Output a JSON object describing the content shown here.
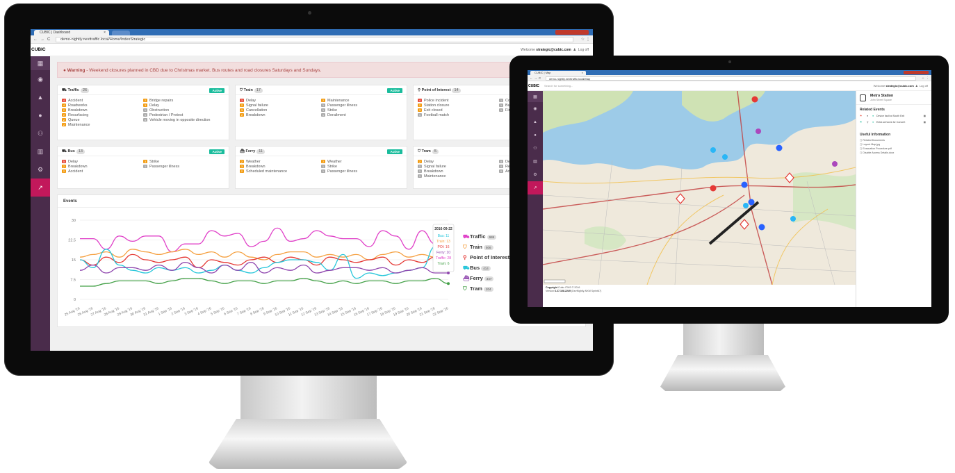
{
  "dashboard": {
    "tab_title": "CUBIC | Dashboard",
    "tab_close": "×",
    "url": "demo-nightly.nexttraffic.local/Home/IndexStrategic",
    "brand": "CUBIC",
    "welcome_prefix": "Welcome",
    "welcome_user": "strategic@cubic.com",
    "logout": "Log off",
    "warning_label": "Warning",
    "warning_text": " - Weekend closures planned in CBD due to Christmas market. Bus routes and road closures Saturdays and Sundays.",
    "active_label": "Active",
    "cards": {
      "traffic": {
        "title": "Traffic",
        "count": "26",
        "left": [
          {
            "n": "4",
            "c": "red",
            "t": "Accident"
          },
          {
            "n": "4",
            "c": "orange",
            "t": "Roadworks"
          },
          {
            "n": "2",
            "c": "orange",
            "t": "Breakdown"
          },
          {
            "n": "2",
            "c": "orange",
            "t": "Resurfacing"
          },
          {
            "n": "2",
            "c": "orange",
            "t": "Queue"
          },
          {
            "n": "2",
            "c": "orange",
            "t": "Maintenance"
          }
        ],
        "right": [
          {
            "n": "2",
            "c": "orange",
            "t": "Bridge repairs"
          },
          {
            "n": "3",
            "c": "orange",
            "t": "Delay"
          },
          {
            "n": "1",
            "c": "grey",
            "t": "Obstruction"
          },
          {
            "n": "1",
            "c": "grey",
            "t": "Pedestrian / Protest"
          },
          {
            "n": "0",
            "c": "grey",
            "t": "Vehicle moving in opposite direction"
          }
        ]
      },
      "train": {
        "title": "Train",
        "count": "17",
        "left": [
          {
            "n": "3",
            "c": "red",
            "t": "Delay"
          },
          {
            "n": "2",
            "c": "orange",
            "t": "Signal failure"
          },
          {
            "n": "3",
            "c": "orange",
            "t": "Cancellation"
          },
          {
            "n": "2",
            "c": "orange",
            "t": "Breakdown"
          }
        ],
        "right": [
          {
            "n": "2",
            "c": "orange",
            "t": "Maintenance"
          },
          {
            "n": "1",
            "c": "grey",
            "t": "Passenger illness"
          },
          {
            "n": "1",
            "c": "grey",
            "t": "Strike"
          },
          {
            "n": "1",
            "c": "grey",
            "t": "Derailment"
          }
        ]
      },
      "poi": {
        "title": "Point of Interest",
        "count": "14",
        "left": [
          {
            "n": "4",
            "c": "red",
            "t": "Police incident"
          },
          {
            "n": "2",
            "c": "orange",
            "t": "Station closure"
          },
          {
            "n": "3",
            "c": "orange",
            "t": "Exit closed"
          },
          {
            "n": "1",
            "c": "grey",
            "t": "Football match"
          }
        ],
        "right": [
          {
            "n": "1",
            "c": "grey",
            "t": "Co"
          },
          {
            "n": "1",
            "c": "grey",
            "t": "Bu"
          },
          {
            "n": "1",
            "c": "grey",
            "t": "Fir"
          }
        ]
      },
      "bus": {
        "title": "Bus",
        "count": "13",
        "left": [
          {
            "n": "5",
            "c": "red",
            "t": "Delay"
          },
          {
            "n": "2",
            "c": "orange",
            "t": "Breakdown"
          },
          {
            "n": "2",
            "c": "orange",
            "t": "Accident"
          }
        ],
        "right": [
          {
            "n": "3",
            "c": "orange",
            "t": "Strike"
          },
          {
            "n": "1",
            "c": "grey",
            "t": "Passenger illness"
          }
        ]
      },
      "ferry": {
        "title": "Ferry",
        "count": "11",
        "left": [
          {
            "n": "2",
            "c": "orange",
            "t": "Weather"
          },
          {
            "n": "3",
            "c": "orange",
            "t": "Breakdown"
          },
          {
            "n": "2",
            "c": "orange",
            "t": "Scheduled maintenance"
          }
        ],
        "right": [
          {
            "n": "2",
            "c": "orange",
            "t": "Weather"
          },
          {
            "n": "1",
            "c": "grey",
            "t": "Strike"
          },
          {
            "n": "1",
            "c": "grey",
            "t": "Passenger illness"
          }
        ]
      },
      "tram": {
        "title": "Tram",
        "count": "5",
        "left": [
          {
            "n": "2",
            "c": "orange",
            "t": "Delay"
          },
          {
            "n": "1",
            "c": "grey",
            "t": "Signal failure"
          },
          {
            "n": "1",
            "c": "grey",
            "t": "Breakdown"
          },
          {
            "n": "1",
            "c": "grey",
            "t": "Maintenance"
          }
        ],
        "right": [
          {
            "n": "0",
            "c": "grey",
            "t": "De"
          },
          {
            "n": "0",
            "c": "grey",
            "t": "Re"
          },
          {
            "n": "0",
            "c": "grey",
            "t": "Acc"
          }
        ]
      }
    },
    "events_title": "Events",
    "events_corner": "la"
  },
  "chart_data": {
    "type": "line",
    "title": "Events",
    "yticks": [
      "30",
      "22.5",
      "15",
      "7.5",
      "0"
    ],
    "ylim": [
      0,
      30
    ],
    "x": [
      "25 Aug '16",
      "26 Aug '16",
      "27 Aug '16",
      "28 Aug '16",
      "29 Aug '16",
      "30 Aug '16",
      "31 Aug '16",
      "1 Sep '16",
      "2 Sep '16",
      "3 Sep '16",
      "4 Sep '16",
      "5 Sep '16",
      "6 Sep '16",
      "7 Sep '16",
      "8 Sep '16",
      "9 Sep '16",
      "10 Sep '16",
      "11 Sep '16",
      "12 Sep '16",
      "13 Sep '16",
      "14 Sep '16",
      "15 Sep '16",
      "16 Sep '16",
      "17 Sep '16",
      "18 Sep '16",
      "19 Sep '16",
      "20 Sep '16",
      "21 Sep '16",
      "22 Sep '16"
    ],
    "series": [
      {
        "name": "Traffic",
        "total": "686",
        "color": "#e040c8",
        "values": [
          23,
          23,
          19,
          24,
          22,
          24,
          24,
          18,
          21,
          21,
          26,
          24,
          25,
          20,
          22,
          27,
          22,
          23,
          26,
          24,
          23,
          23,
          20,
          26,
          24,
          19,
          26,
          21,
          28
        ]
      },
      {
        "name": "Train",
        "total": "506",
        "color": "#f5a142",
        "values": [
          16,
          17,
          18,
          16,
          19,
          18,
          17,
          18,
          19,
          17,
          18,
          16,
          18,
          16,
          15,
          17,
          18,
          18,
          16,
          17,
          16,
          17,
          15,
          17,
          18,
          16,
          17,
          16,
          13
        ]
      },
      {
        "name": "Point of Interest",
        "total": "437",
        "color": "#e53935",
        "values": [
          15,
          13,
          16,
          14,
          17,
          15,
          14,
          15,
          16,
          12,
          15,
          14,
          13,
          15,
          16,
          14,
          16,
          15,
          13,
          16,
          15,
          14,
          15,
          16,
          13,
          15,
          14,
          16,
          16
        ]
      },
      {
        "name": "Bus",
        "total": "414",
        "color": "#26c6da",
        "values": [
          15,
          12,
          19,
          13,
          11,
          10,
          12,
          11,
          12,
          10,
          11,
          13,
          11,
          10,
          12,
          14,
          15,
          15,
          14,
          11,
          17,
          8,
          10,
          9,
          10,
          11,
          12,
          20,
          11
        ]
      },
      {
        "name": "Ferry",
        "total": "347",
        "color": "#8e44ad",
        "values": [
          11,
          13,
          10,
          12,
          12,
          11,
          13,
          11,
          14,
          12,
          10,
          13,
          11,
          14,
          10,
          12,
          11,
          13,
          10,
          11,
          12,
          12,
          11,
          12,
          10,
          11,
          12,
          10,
          10
        ]
      },
      {
        "name": "Tram",
        "total": "204",
        "color": "#43a047",
        "values": [
          5,
          5,
          6,
          7,
          7,
          7,
          6,
          7,
          8,
          8,
          7,
          6,
          7,
          7,
          6,
          7,
          7,
          8,
          7,
          6,
          7,
          6,
          7,
          7,
          6,
          7,
          7,
          8,
          6
        ]
      }
    ],
    "tooltip": {
      "date": "2016-09-22",
      "lines": [
        "Bus: 11",
        "Train: 13",
        "POI: 16",
        "Ferry: 10",
        "Traffic: 28",
        "Tram: 6"
      ]
    },
    "legend": "right"
  },
  "mapapp": {
    "tab_title": "CUBIC | Map",
    "tab_close": "×",
    "url": "demo-nightly.nexttraffic.local/Map",
    "brand": "CUBIC",
    "search_placeholder": "Search for something...",
    "welcome_prefix": "Welcome",
    "welcome_user": "strategic@cubic.com",
    "logout": "Log off",
    "station_title": "Metro Station",
    "station_sub": "John Street Square",
    "related_title": "Related Events",
    "related": [
      "Device fault at South Exit",
      "Extra services for Concert"
    ],
    "useful_title": "Useful Information",
    "useful": [
      "Related Documents",
      "Layout Map.jpg",
      "Evacuation Procedure.pdf",
      "Disable Access Details.docx"
    ],
    "copyright_label": "Copyright",
    "copyright_text": "Cubic ITMS © 2016",
    "version_label": "Version",
    "version_value": "6.27.108.2249",
    "version_extra": "(DevNightly-NXM Sprint67)"
  }
}
